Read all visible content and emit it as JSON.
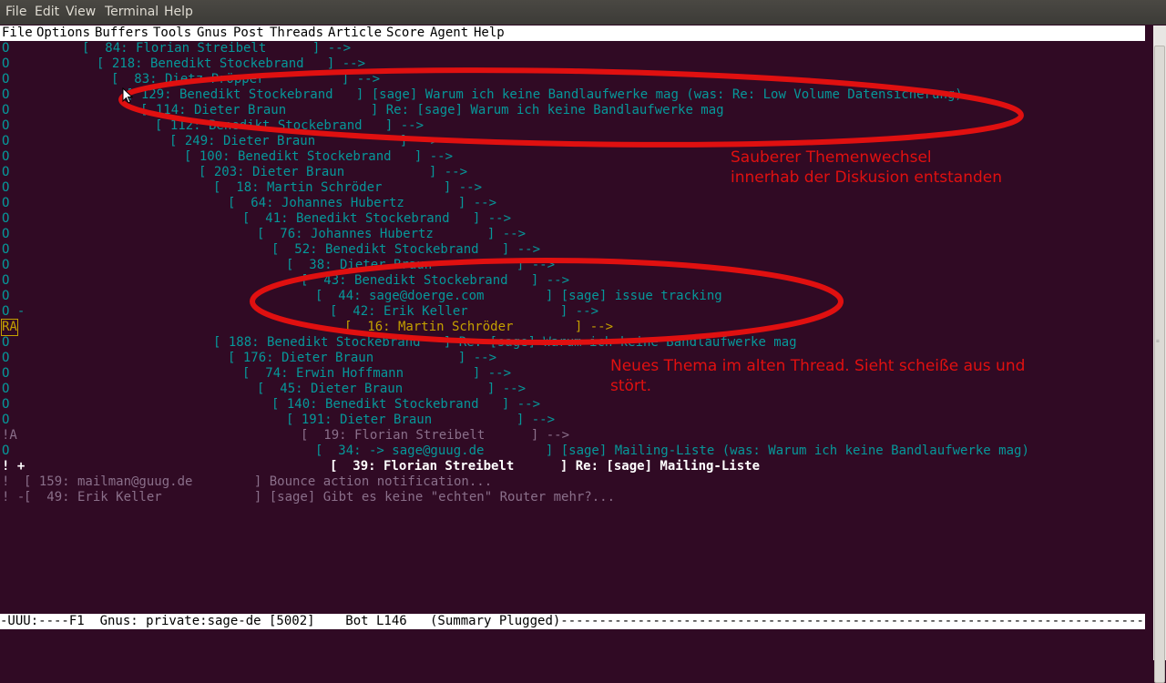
{
  "terminal_menu": [
    "File",
    "Edit",
    "View",
    "Terminal",
    "Help"
  ],
  "emacs_menu": [
    "File",
    "Options",
    "Buffers",
    "Tools",
    "Gnus",
    "Post",
    "Threads",
    "Article",
    "Score",
    "Agent",
    "Help"
  ],
  "summary_lines": [
    {
      "mark": "O",
      "text": "[  84: Florian Streibelt      ] -->",
      "indent": 11
    },
    {
      "mark": "O",
      "text": "[ 218: Benedikt Stockebrand   ] -->",
      "indent": 13
    },
    {
      "mark": "O",
      "text": "[  83: Dietz Pröpper          ] -->",
      "indent": 15
    },
    {
      "mark": "O",
      "text": "[ 129: Benedikt Stockebrand   ] [sage] Warum ich keine Bandlaufwerke mag (was: Re: Low Volume Datensicherung)",
      "indent": 17
    },
    {
      "mark": "O",
      "text": "[ 114: Dieter Braun           ] Re: [sage] Warum ich keine Bandlaufwerke mag",
      "indent": 19
    },
    {
      "mark": "O",
      "text": "[ 112: Benedikt Stockebrand   ] -->",
      "indent": 21
    },
    {
      "mark": "O",
      "text": "[ 249: Dieter Braun           ] -->",
      "indent": 23
    },
    {
      "mark": "O",
      "text": "[ 100: Benedikt Stockebrand   ] -->",
      "indent": 25
    },
    {
      "mark": "O",
      "text": "[ 203: Dieter Braun           ] -->",
      "indent": 27
    },
    {
      "mark": "O",
      "text": "[  18: Martin Schröder        ] -->",
      "indent": 29
    },
    {
      "mark": "O",
      "text": "[  64: Johannes Hubertz       ] -->",
      "indent": 31
    },
    {
      "mark": "O",
      "text": "[  41: Benedikt Stockebrand   ] -->",
      "indent": 33
    },
    {
      "mark": "O",
      "text": "[  76: Johannes Hubertz       ] -->",
      "indent": 35
    },
    {
      "mark": "O",
      "text": "[  52: Benedikt Stockebrand   ] -->",
      "indent": 37
    },
    {
      "mark": "O",
      "text": "[  38: Dieter Braun           ] -->",
      "indent": 39
    },
    {
      "mark": "O",
      "text": "[  43: Benedikt Stockebrand   ] -->",
      "indent": 41
    },
    {
      "mark": "O",
      "text": "[  44: sage@doerge.com        ] [sage] issue tracking",
      "indent": 43
    },
    {
      "mark": "O -",
      "text": "[  42: Erik Keller            ] -->",
      "indent": 45
    },
    {
      "mark": "RA",
      "text": "[  16: Martin Schröder        ] -->",
      "indent": 47,
      "style": "current"
    },
    {
      "mark": "O",
      "text": "[ 188: Benedikt Stockebrand   ] Re: [sage] Warum ich keine Bandlaufwerke mag",
      "indent": 29
    },
    {
      "mark": "O",
      "text": "[ 176: Dieter Braun           ] -->",
      "indent": 31
    },
    {
      "mark": "O",
      "text": "[  74: Erwin Hoffmann         ] -->",
      "indent": 33
    },
    {
      "mark": "O",
      "text": "[  45: Dieter Braun           ] -->",
      "indent": 35
    },
    {
      "mark": "O",
      "text": "[ 140: Benedikt Stockebrand   ] -->",
      "indent": 37
    },
    {
      "mark": "O",
      "text": "[ 191: Dieter Braun           ] -->",
      "indent": 39
    },
    {
      "mark": "!A",
      "text": "[  19: Florian Streibelt      ] -->",
      "indent": 41,
      "style": "dim"
    },
    {
      "mark": "O",
      "text": "[  34: -> sage@guug.de        ] [sage] Mailing-Liste (was: Warum ich keine Bandlaufwerke mag)",
      "indent": 43
    },
    {
      "mark": "! +",
      "text": "[  39: Florian Streibelt      ] Re: [sage] Mailing-Liste",
      "indent": 45,
      "style": "bright"
    },
    {
      "mark": "!",
      "text": "[ 159: mailman@guug.de        ] Bounce action notification...",
      "indent": 3,
      "style": "dim"
    },
    {
      "mark": "! -",
      "text": "[  49: Erik Keller            ] [sage] Gibt es keine \"echten\" Router mehr?...",
      "indent": 3,
      "style": "dim"
    }
  ],
  "modeline": "-UUU:----F1  Gnus: private:sage-de [5002]    Bot L146   (Summary Plugged)-------------------------------------------------------------------------------------------------------",
  "annotations": {
    "note1_line1": "Sauberer Themenwechsel",
    "note1_line2": "innerhab der Diskusion entstanden",
    "note2_line1": "Neues Thema im alten Thread. Sieht scheiße aus und",
    "note2_line2": "stört."
  },
  "colors": {
    "background": "#300a24",
    "summary_text": "#06989a",
    "current_line": "#c4a000",
    "annotation_red": "#e01010"
  }
}
